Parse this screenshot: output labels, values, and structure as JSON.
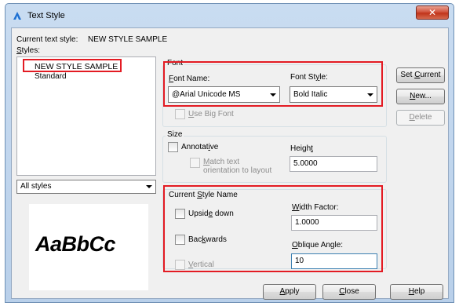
{
  "window": {
    "title": "Text Style",
    "close_symbol": "✕"
  },
  "current_style": {
    "label": "Current text style:",
    "value": "NEW STYLE SAMPLE"
  },
  "styles": {
    "label": "Styles:",
    "items": [
      "NEW STYLE SAMPLE",
      "Standard"
    ],
    "filter_value": "All styles",
    "preview_text": "AaBbCc"
  },
  "font": {
    "group_label": "Font",
    "name_label": "Font Name:",
    "name_value": "@Arial Unicode MS",
    "style_label": "Font Style:",
    "style_value": "Bold Italic",
    "big_font_label": "Use Big Font"
  },
  "size": {
    "group_label": "Size",
    "annotative_label": "Annotative",
    "match_label_line1": "Match text",
    "match_label_line2": "orientation to layout",
    "height_label": "Height",
    "height_value": "5.0000"
  },
  "effects": {
    "group_label": "Current Style Name",
    "upside_down_label": "Upside down",
    "backwards_label": "Backwards",
    "vertical_label": "Vertical",
    "width_factor_label": "Width Factor:",
    "width_factor_value": "1.0000",
    "oblique_label": "Oblique Angle:",
    "oblique_value": "10"
  },
  "buttons": {
    "set_current": "Set Current",
    "new": "New...",
    "delete": "Delete",
    "apply": "Apply",
    "close": "Close",
    "help": "Help"
  },
  "colors": {
    "highlight_box": "#e31b23",
    "title_gradient": "#c9dcf1"
  },
  "icons": {
    "app": "autocad-logo-icon"
  }
}
